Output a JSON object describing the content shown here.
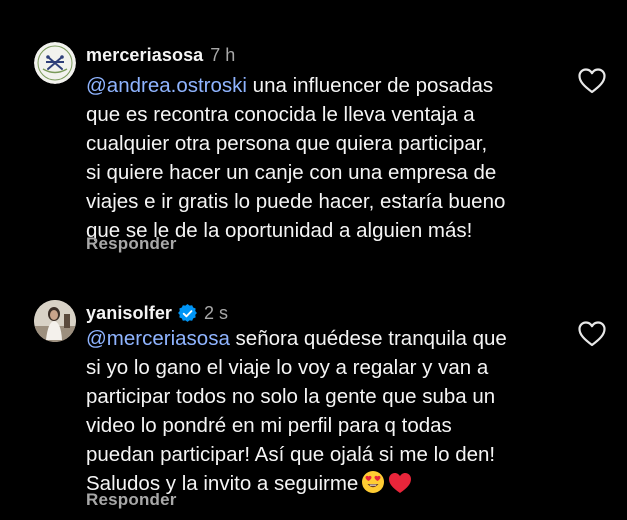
{
  "comments": [
    {
      "username": "merceriasosa",
      "time": "7 h",
      "verified": false,
      "mention": "@andrea.ostroski",
      "lines": [
        " una influencer de posadas",
        "que es recontra conocida le lleva ventaja a",
        "cualquier otra persona que quiera participar,",
        "si quiere hacer un canje con una empresa de",
        "viajes e ir gratis lo puede hacer, estaría bueno",
        "que se le de la oportunidad a alguien más!"
      ],
      "reply_label": "Responder",
      "icons": {
        "avatar": "merceria-logo-avatar",
        "like": "heart-outline-icon"
      }
    },
    {
      "username": "yanisolfer",
      "time": "2 s",
      "verified": true,
      "mention": "@merceriasosa",
      "lines": [
        " señora quédese tranquila que",
        "si yo lo gano el viaje lo voy a regalar y van a",
        "participar todos no solo la gente que suba un",
        "video lo pondré en mi perfil para q todas",
        "puedan participar! Así que ojalá si me lo den!",
        "Saludos y la invito a seguirme"
      ],
      "emojis": [
        "heart-eyes-emoji",
        "red-heart-emoji"
      ],
      "reply_label": "Responder",
      "icons": {
        "avatar": "user-photo-avatar",
        "verified": "verified-badge-icon",
        "like": "heart-outline-icon"
      }
    }
  ],
  "colors": {
    "background": "#000000",
    "text": "#f5f5f5",
    "muted": "#a8a8a8",
    "mention": "#8fb4ff",
    "verified": "#0095f6"
  }
}
